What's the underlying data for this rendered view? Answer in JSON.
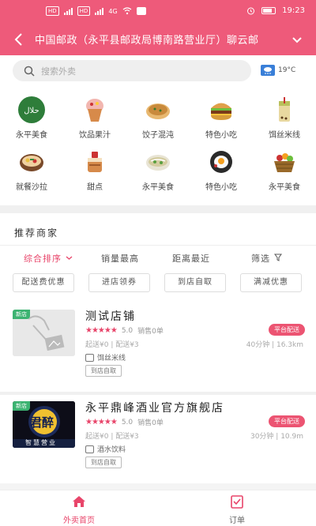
{
  "status_bar": {
    "sim1": "HD",
    "sim2": "HD",
    "network": "4G",
    "time": "19:23"
  },
  "header": {
    "title": "中国邮政（永平县邮政局博南路营业厅）聊云邮",
    "bg_color": "#ee5a7a"
  },
  "search": {
    "placeholder": "搜索外卖",
    "icon": "search-icon",
    "weather_icon": "cloud-rain-icon",
    "temperature": "19°C"
  },
  "categories": [
    {
      "label": "永平美食",
      "icon": "halal-icon",
      "color": "#2e7d3a"
    },
    {
      "label": "饮品果汁",
      "icon": "icecream-icon",
      "color": "#d78a4a"
    },
    {
      "label": "饺子混沌",
      "icon": "pancake-icon",
      "color": "#c98a3c"
    },
    {
      "label": "特色小吃",
      "icon": "burger-icon",
      "color": "#d59b3c"
    },
    {
      "label": "饵丝米线",
      "icon": "bubbletea-icon",
      "color": "#b9c05c"
    },
    {
      "label": "就餐沙拉",
      "icon": "hotpot-icon",
      "color": "#a86a3a"
    },
    {
      "label": "甜点",
      "icon": "cake-icon",
      "color": "#d68a4a"
    },
    {
      "label": "永平美食",
      "icon": "noodles-icon",
      "color": "#b8b090"
    },
    {
      "label": "特色小吃",
      "icon": "egg-pan-icon",
      "color": "#2a2a2a"
    },
    {
      "label": "永平美食",
      "icon": "basket-icon",
      "color": "#9a6a2a"
    }
  ],
  "recommend": {
    "title": "推荐商家",
    "sorts": [
      {
        "label": "综合排序",
        "active": true,
        "dropdown": true
      },
      {
        "label": "销量最高",
        "active": false
      },
      {
        "label": "距离最近",
        "active": false
      },
      {
        "label": "筛选",
        "active": false,
        "filter": true
      }
    ],
    "chips": [
      "配送费优惠",
      "进店领券",
      "到店自取",
      "满减优惠"
    ]
  },
  "shops": [
    {
      "name": "测试店铺",
      "tag": "新店",
      "rating": "5.0",
      "sales": "销售0单",
      "badge": "平台配送",
      "fee": "起送¥0 | 配送¥3",
      "distance": "40分钟 | 16.3km",
      "category": "饵丝米线",
      "pickup": "到店自取",
      "image": "placeholder-image-icon"
    },
    {
      "name": "永平鼎峰酒业官方旗舰店",
      "tag": "新店",
      "rating": "5.0",
      "sales": "销售0单",
      "badge": "平台配送",
      "fee": "起送¥0 | 配送¥3",
      "distance": "30分钟 | 10.9m",
      "category": "酒水饮料",
      "pickup": "到店自取",
      "image": "liquor-logo-icon",
      "logo_text": "君醉",
      "logo_sub": "智慧营业"
    }
  ],
  "bottom_nav": [
    {
      "label": "外卖首页",
      "icon": "home-icon",
      "active": true
    },
    {
      "label": "订单",
      "icon": "order-icon",
      "active": false
    }
  ],
  "accent": "#e8456a"
}
